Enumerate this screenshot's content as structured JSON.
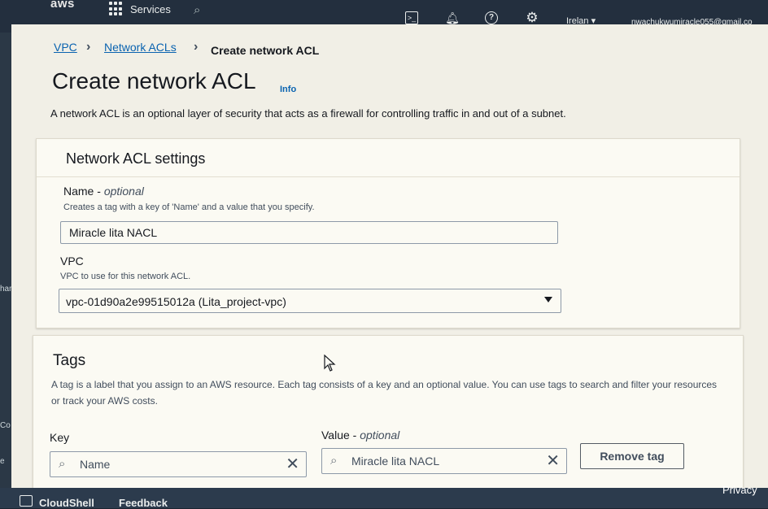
{
  "topbar": {
    "logo": "aws",
    "services": "Services",
    "region": "Irelan ▾",
    "account": "nwachukwumiracle055@gmail.co"
  },
  "icons": {
    "menu": "grid-icon",
    "search": "search-icon",
    "cloudshell": "cloudshell-icon",
    "notifications": "bell-icon",
    "help": "help-icon",
    "settings": "gear-icon"
  },
  "breadcrumb": {
    "items": [
      "VPC",
      "Network ACLs",
      "Create network ACL"
    ]
  },
  "header": {
    "title": "Create network ACL",
    "info": "Info",
    "description": "A network ACL is an optional layer of security that acts as a firewall for controlling traffic in and out of a subnet."
  },
  "settings": {
    "title": "Network ACL settings",
    "name_label": "Name",
    "name_optional": "optional",
    "name_hint": "Creates a tag with a key of 'Name' and a value that you specify.",
    "name_value": "Miracle lita NACL",
    "vpc_label": "VPC",
    "vpc_hint": "VPC to use for this network ACL.",
    "vpc_value": "vpc-01d90a2e99515012a (Lita_project-vpc)"
  },
  "tags": {
    "title": "Tags",
    "description": "A tag is a label that you assign to an AWS resource. Each tag consists of a key and an optional value. You can use tags to search and filter your resources or track your AWS costs.",
    "key_label": "Key",
    "value_label": "Value",
    "value_optional": "optional",
    "key_value": "Name",
    "value_value": "Miracle lita NACL",
    "remove_button": "Remove tag"
  },
  "footer": {
    "cloudshell": "CloudShell",
    "feedback": "Feedback",
    "privacy": "Privacy"
  },
  "sidebar_fragments": [
    "har",
    "Co",
    "e"
  ]
}
